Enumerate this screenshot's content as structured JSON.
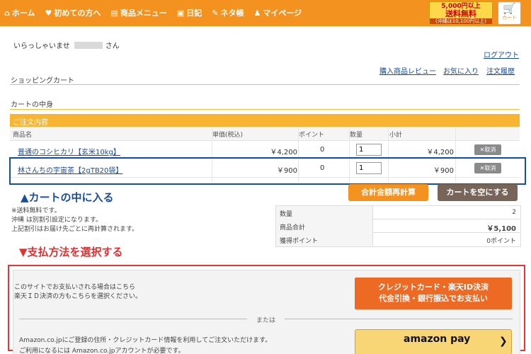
{
  "header": {
    "nav": [
      {
        "icon": "home-icon",
        "glyph": "⌂",
        "label": "ホーム"
      },
      {
        "icon": "beginner-icon",
        "glyph": "♥",
        "label": "初めての方へ"
      },
      {
        "icon": "menu-icon",
        "glyph": "▤",
        "label": "商品メニュー"
      },
      {
        "icon": "diary-icon",
        "glyph": "▣",
        "label": "日記"
      },
      {
        "icon": "neta-icon",
        "glyph": "✎",
        "label": "ネタ帳"
      },
      {
        "icon": "mypage-icon",
        "glyph": "♟",
        "label": "マイページ"
      }
    ],
    "shipping_badge": {
      "line1": "5,000円以上",
      "line2": "送料無料",
      "line3": "(沖縄は10,100円以上)"
    },
    "cart_label": "カート"
  },
  "welcome": {
    "prefix": "いらっしゃいませ",
    "suffix": "さん"
  },
  "logout": "ログアウト",
  "section_shopping_cart": "ショッピングカート",
  "links": {
    "review": "購入商品レビュー",
    "favorites": "お気に入り",
    "history": "注文履歴"
  },
  "section_cart_contents": "カートの中身",
  "order_header": "ご注文内容",
  "columns": {
    "name": "商品名",
    "price": "単価(税込)",
    "points": "ポイント",
    "qty": "数量",
    "subtotal": "小計"
  },
  "items": [
    {
      "name": "普通のコシヒカリ【玄米10kg】",
      "price": "￥4,200",
      "points": "0",
      "qty": "1",
      "subtotal": "￥4,200",
      "remove": "✕取消"
    },
    {
      "name": "林さんちの宇宙茶【2gTB20袋】",
      "price": "￥900",
      "points": "0",
      "qty": "1",
      "subtotal": "￥900",
      "remove": "✕取消"
    }
  ],
  "annotation_blue": "▲カートの中に入る",
  "annotation_red": "▼支払方法を選択する",
  "buttons": {
    "recalc": "合計金額再計算",
    "empty": "カートを空にする"
  },
  "notes": [
    "※送料無料です。",
    "沖縄 は別割引設定になります。",
    "上記割引はお届け先ごとに再計算されます。"
  ],
  "summary": [
    {
      "label": "数量",
      "value": "2"
    },
    {
      "label": "商品合計",
      "value": "￥5,100"
    },
    {
      "label": "獲得ポイント",
      "value": "0ポイント"
    }
  ],
  "payment": {
    "text1_line1": "このサイトでお支払いされる場合はこちら",
    "text1_line2": "楽天ＩＤ決済の方もこちらを選択ください。",
    "credit_line1": "クレジットカード・楽天ID決済",
    "credit_line2": "代金引換・銀行振込でお支払い",
    "or": "または",
    "text2_line1": "Amazon.co.jpにご登録の住所・クレジットカード情報を利用してご注文いただけます。",
    "text2_line2": "ご利用になるには Amazon.co.jpアカウントが必要です。",
    "amazon_label": "amazon pay",
    "amazon_chevron": "❯"
  },
  "colors": {
    "header": "#f4921f",
    "accent_blue": "#1a4d9b",
    "accent_red": "#e53535"
  }
}
